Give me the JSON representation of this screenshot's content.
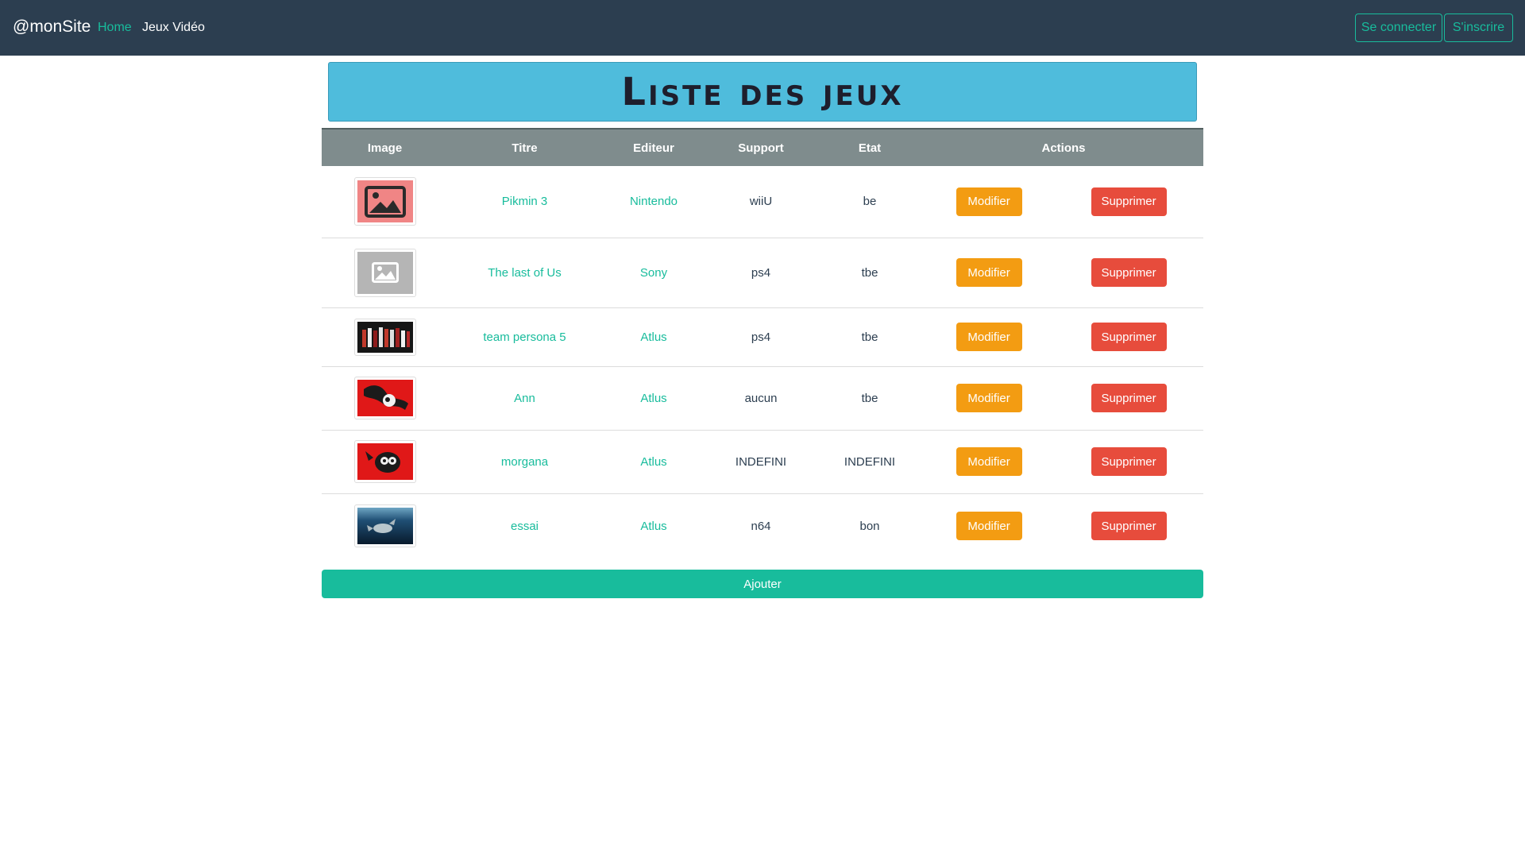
{
  "navbar": {
    "brand": "@monSite",
    "links": [
      "Home",
      "Jeux Vidéo"
    ],
    "login_label": "Se connecter",
    "signup_label": "S'inscrire"
  },
  "banner": {
    "title": "Liste des jeux"
  },
  "table": {
    "headers": [
      "Image",
      "Titre",
      "Editeur",
      "Support",
      "Etat",
      "Actions"
    ],
    "modify_label": "Modifier",
    "delete_label": "Supprimer",
    "rows": [
      {
        "image": "placeholder-image-icon",
        "titre": "Pikmin 3",
        "editeur": "Nintendo",
        "support": "wiiU",
        "etat": "be"
      },
      {
        "image": "placeholder-image-icon",
        "titre": "The last of Us",
        "editeur": "Sony",
        "support": "ps4",
        "etat": "tbe"
      },
      {
        "image": "group-photo-thumbnail",
        "titre": "team persona 5",
        "editeur": "Atlus",
        "support": "ps4",
        "etat": "tbe"
      },
      {
        "image": "character-art-thumbnail",
        "titre": "Ann",
        "editeur": "Atlus",
        "support": "aucun",
        "etat": "tbe"
      },
      {
        "image": "character-art-thumbnail",
        "titre": "morgana",
        "editeur": "Atlus",
        "support": "INDEFINI",
        "etat": "INDEFINI"
      },
      {
        "image": "underwater-photo-thumbnail",
        "titre": "essai",
        "editeur": "Atlus",
        "support": "n64",
        "etat": "bon"
      }
    ]
  },
  "add_button": {
    "label": "Ajouter"
  },
  "colors": {
    "navbar": "#2c3e50",
    "accent": "#18bc9c",
    "banner": "#4fbcdc",
    "table_header": "#7f8c8d",
    "modify": "#f39c12",
    "delete": "#e74c3c"
  }
}
